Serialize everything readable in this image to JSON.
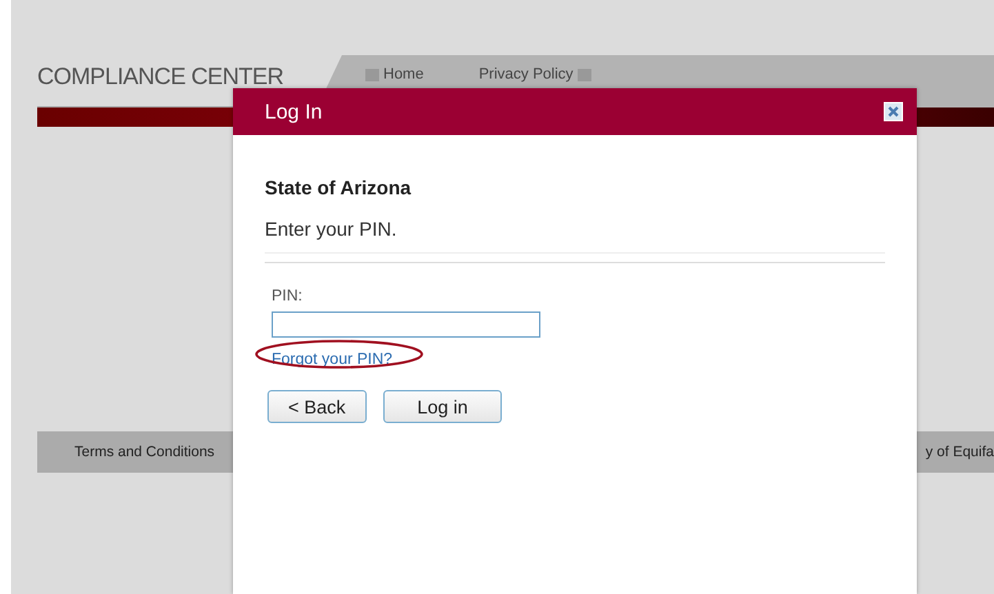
{
  "header": {
    "title": "COMPLIANCE CENTER",
    "nav": [
      {
        "label": "Home"
      },
      {
        "label": "Privacy Policy"
      }
    ]
  },
  "footer": {
    "links": [
      "Terms and Conditions",
      "y of Equifa"
    ]
  },
  "dialog": {
    "title": "Log In",
    "heading": "State of Arizona",
    "instruction": "Enter your PIN.",
    "field_label": "PIN:",
    "link": "Forgot your PIN?",
    "link_highlighted": true,
    "buttons": [
      {
        "label": "< Back"
      },
      {
        "label": "Log in"
      }
    ]
  }
}
